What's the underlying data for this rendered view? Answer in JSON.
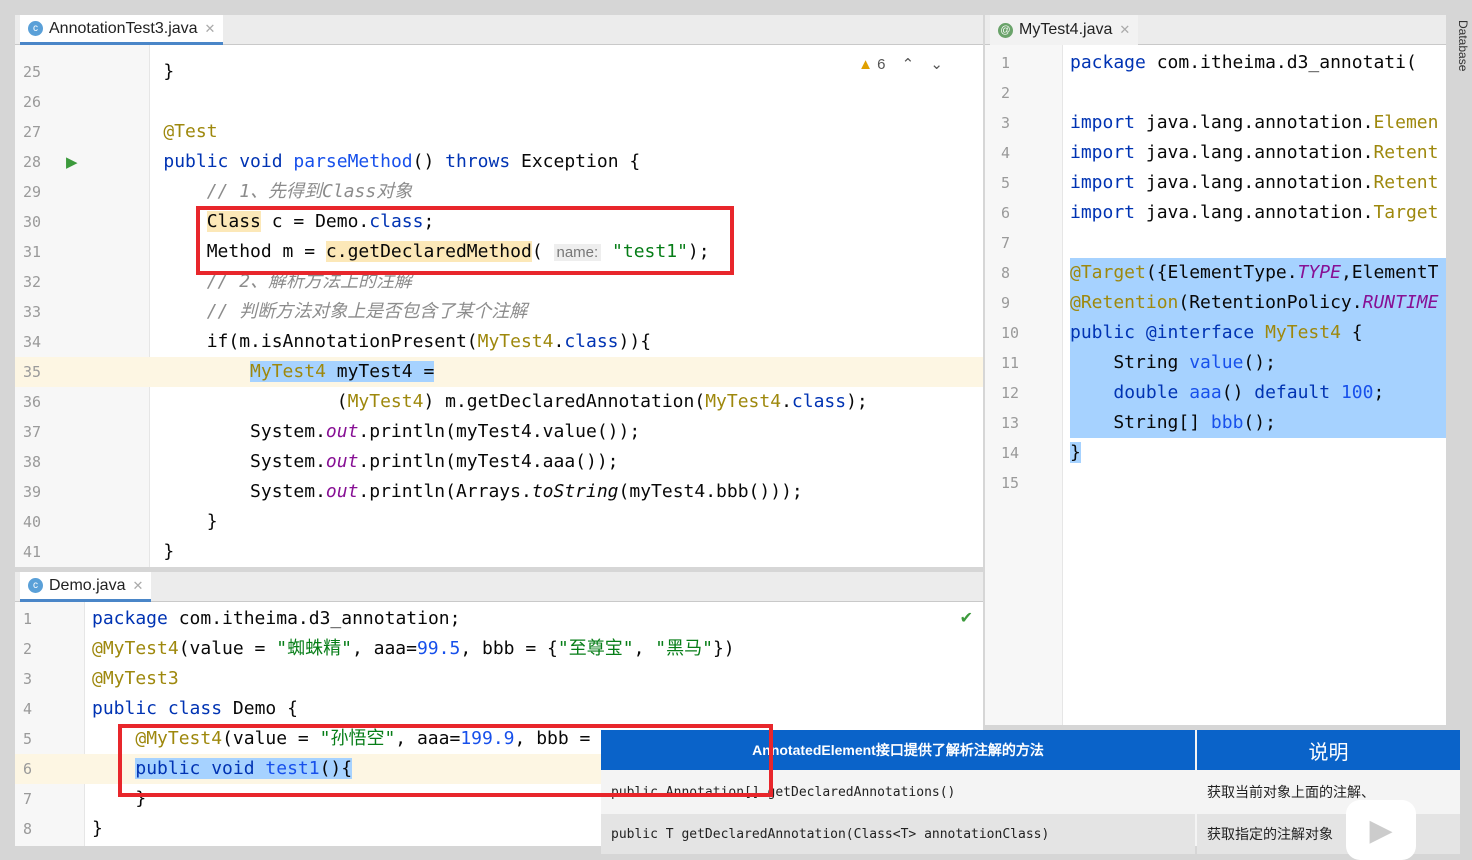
{
  "top_editor": {
    "tab": "AnnotationTest3.java",
    "warnings": "6",
    "lines": [
      {
        "n": "25",
        "t": [
          [
            "    }",
            "t"
          ]
        ]
      },
      {
        "n": "26",
        "t": []
      },
      {
        "n": "27",
        "t": [
          [
            "    @Test",
            "a"
          ]
        ]
      },
      {
        "n": "28",
        "t": [
          [
            "    ",
            "t"
          ],
          [
            "public void ",
            "k"
          ],
          [
            "parseMethod",
            "n"
          ],
          [
            "() ",
            "t"
          ],
          [
            "throws ",
            "k"
          ],
          [
            "Exception {",
            "t"
          ]
        ]
      },
      {
        "n": "29",
        "t": [
          [
            "        // 1、先得到Class对象",
            "c"
          ]
        ]
      },
      {
        "n": "30",
        "t": [
          [
            "        ",
            "t"
          ],
          [
            "Class",
            "t",
            "hl"
          ],
          [
            " c = Demo.",
            "t"
          ],
          [
            "class",
            "k"
          ],
          [
            ";",
            "t"
          ]
        ]
      },
      {
        "n": "31",
        "t": [
          [
            "        Method m = ",
            "t"
          ],
          [
            "c.getDeclaredMethod",
            "t",
            "hl"
          ],
          [
            "( ",
            "t"
          ],
          [
            "name:",
            "h"
          ],
          [
            " ",
            "t"
          ],
          [
            "\"test1\"",
            "s"
          ],
          [
            ");",
            "t"
          ]
        ]
      },
      {
        "n": "32",
        "t": [
          [
            "        // 2、解析方法上的注解",
            "c"
          ]
        ]
      },
      {
        "n": "33",
        "t": [
          [
            "        // 判断方法对象上是否包含了某个注解",
            "c"
          ]
        ]
      },
      {
        "n": "34",
        "t": [
          [
            "        if(m.isAnnotationPresent(",
            "t"
          ],
          [
            "MyTest4",
            "a"
          ],
          [
            ".",
            "t"
          ],
          [
            "class",
            "k"
          ],
          [
            ")){",
            "t"
          ]
        ]
      },
      {
        "n": "35",
        "t": [
          [
            "            ",
            "t"
          ],
          [
            "MyTest4",
            "a",
            "sel"
          ],
          [
            " myTest4 =",
            "t",
            "sel"
          ]
        ],
        "current": true
      },
      {
        "n": "36",
        "t": [
          [
            "                    (",
            "t"
          ],
          [
            "MyTest4",
            "a"
          ],
          [
            ") m.getDeclaredAnnotation(",
            "t"
          ],
          [
            "MyTest4",
            "a"
          ],
          [
            ".",
            "t"
          ],
          [
            "class",
            "k"
          ],
          [
            ");",
            "t"
          ]
        ]
      },
      {
        "n": "37",
        "t": [
          [
            "            System.",
            "t"
          ],
          [
            "out",
            "f"
          ],
          [
            ".println(myTest4.value());",
            "t"
          ]
        ]
      },
      {
        "n": "38",
        "t": [
          [
            "            System.",
            "t"
          ],
          [
            "out",
            "f"
          ],
          [
            ".println(myTest4.aaa());",
            "t"
          ]
        ]
      },
      {
        "n": "39",
        "t": [
          [
            "            System.",
            "t"
          ],
          [
            "out",
            "f"
          ],
          [
            ".println(Arrays.",
            "t"
          ],
          [
            "toString",
            "i"
          ],
          [
            "(myTest4.bbb()));",
            "t"
          ]
        ]
      },
      {
        "n": "40",
        "t": [
          [
            "        }",
            "t"
          ]
        ]
      },
      {
        "n": "41",
        "t": [
          [
            "    }",
            "t"
          ]
        ]
      }
    ]
  },
  "right_editor": {
    "tab": "MyTest4.java",
    "side_label": "Database",
    "lines": [
      {
        "n": "1",
        "t": [
          [
            "package ",
            "k"
          ],
          [
            "com.itheima.d3_annotati(",
            "t"
          ]
        ]
      },
      {
        "n": "2",
        "t": []
      },
      {
        "n": "3",
        "t": [
          [
            "import ",
            "k"
          ],
          [
            "java.lang.annotation.",
            "t"
          ],
          [
            "Elemen",
            "a"
          ]
        ]
      },
      {
        "n": "4",
        "t": [
          [
            "import ",
            "k"
          ],
          [
            "java.lang.annotation.",
            "t"
          ],
          [
            "Retent",
            "a"
          ]
        ]
      },
      {
        "n": "5",
        "t": [
          [
            "import ",
            "k"
          ],
          [
            "java.lang.annotation.",
            "t"
          ],
          [
            "Retent",
            "a"
          ]
        ]
      },
      {
        "n": "6",
        "t": [
          [
            "import ",
            "k"
          ],
          [
            "java.lang.annotation.",
            "t"
          ],
          [
            "Target",
            "a"
          ]
        ]
      },
      {
        "n": "7",
        "t": []
      },
      {
        "n": "8",
        "t": [
          [
            "@Target",
            "a",
            "sel"
          ],
          [
            "({ElementType.",
            "t",
            "sel"
          ],
          [
            "TYPE",
            "f",
            "sel"
          ],
          [
            ",ElementT",
            "t",
            "sel"
          ]
        ],
        "sel": true
      },
      {
        "n": "9",
        "t": [
          [
            "@Retention",
            "a",
            "sel"
          ],
          [
            "(RetentionPolicy.",
            "t",
            "sel"
          ],
          [
            "RUNTIME",
            "f",
            "sel"
          ]
        ],
        "sel": true
      },
      {
        "n": "10",
        "t": [
          [
            "public ",
            "k",
            "sel"
          ],
          [
            "@interface ",
            "k",
            "sel"
          ],
          [
            "MyTest4",
            "a",
            "sel"
          ],
          [
            " {",
            "t",
            "sel"
          ]
        ],
        "sel": true
      },
      {
        "n": "11",
        "t": [
          [
            "    String ",
            "t",
            "sel"
          ],
          [
            "value",
            "n",
            "sel"
          ],
          [
            "();",
            "t",
            "sel"
          ]
        ],
        "sel": true
      },
      {
        "n": "12",
        "t": [
          [
            "    ",
            "t",
            "sel"
          ],
          [
            "double ",
            "k",
            "sel"
          ],
          [
            "aaa",
            "n",
            "sel"
          ],
          [
            "() ",
            "t",
            "sel"
          ],
          [
            "default ",
            "k",
            "sel"
          ],
          [
            "100",
            "n",
            "sel"
          ],
          [
            ";",
            "t",
            "sel"
          ]
        ],
        "sel": true
      },
      {
        "n": "13",
        "t": [
          [
            "    String[] ",
            "t",
            "sel"
          ],
          [
            "bbb",
            "n",
            "sel"
          ],
          [
            "();",
            "t",
            "sel"
          ]
        ],
        "sel": true
      },
      {
        "n": "14",
        "t": [
          [
            "}",
            "t",
            "sel"
          ]
        ]
      },
      {
        "n": "15",
        "t": []
      }
    ]
  },
  "bottom_editor": {
    "tab": "Demo.java",
    "lines": [
      {
        "n": "1",
        "t": [
          [
            "package ",
            "k"
          ],
          [
            "com.itheima.d3_annotation;",
            "t"
          ]
        ]
      },
      {
        "n": "2",
        "t": [
          [
            "@MyTest4",
            "a"
          ],
          [
            "(value = ",
            "t"
          ],
          [
            "\"蜘蛛精\"",
            "s"
          ],
          [
            ", aaa=",
            "t"
          ],
          [
            "99.5",
            "n"
          ],
          [
            ", bbb = {",
            "t"
          ],
          [
            "\"至尊宝\"",
            "s"
          ],
          [
            ", ",
            "t"
          ],
          [
            "\"黑马\"",
            "s"
          ],
          [
            "})",
            "t"
          ]
        ]
      },
      {
        "n": "3",
        "t": [
          [
            "@MyTest3",
            "a"
          ]
        ]
      },
      {
        "n": "4",
        "t": [
          [
            "public class ",
            "k"
          ],
          [
            "Demo {",
            "t"
          ]
        ]
      },
      {
        "n": "5",
        "t": [
          [
            "    ",
            "t"
          ],
          [
            "@MyTest4",
            "a"
          ],
          [
            "(value = ",
            "t"
          ],
          [
            "\"孙悟空\"",
            "s"
          ],
          [
            ", aaa=",
            "t"
          ],
          [
            "199.9",
            "n"
          ],
          [
            ", bbb =",
            "t"
          ]
        ]
      },
      {
        "n": "6",
        "t": [
          [
            "    ",
            "t"
          ],
          [
            "public void ",
            "k",
            "sel"
          ],
          [
            "test1",
            "n",
            "sel"
          ],
          [
            "(){",
            "t",
            "sel"
          ]
        ],
        "current": true
      },
      {
        "n": "7",
        "t": [
          [
            "    }",
            "t"
          ]
        ]
      },
      {
        "n": "8",
        "t": [
          [
            "}",
            "t"
          ]
        ]
      }
    ]
  },
  "overlay_table": {
    "headers": [
      "AnnotatedElement接口提供了解析注解的方法",
      "说明"
    ],
    "rows": [
      [
        "public Annotation[] getDeclaredAnnotations()",
        "获取当前对象上面的注解、"
      ],
      [
        "public T getDeclaredAnnotation(Class<T> annotationClass)",
        "获取指定的注解对象"
      ]
    ]
  },
  "colors": {
    "highlight_box": "#e8262b",
    "table_header": "#0a63c9",
    "selection": "#a6d2ff"
  }
}
